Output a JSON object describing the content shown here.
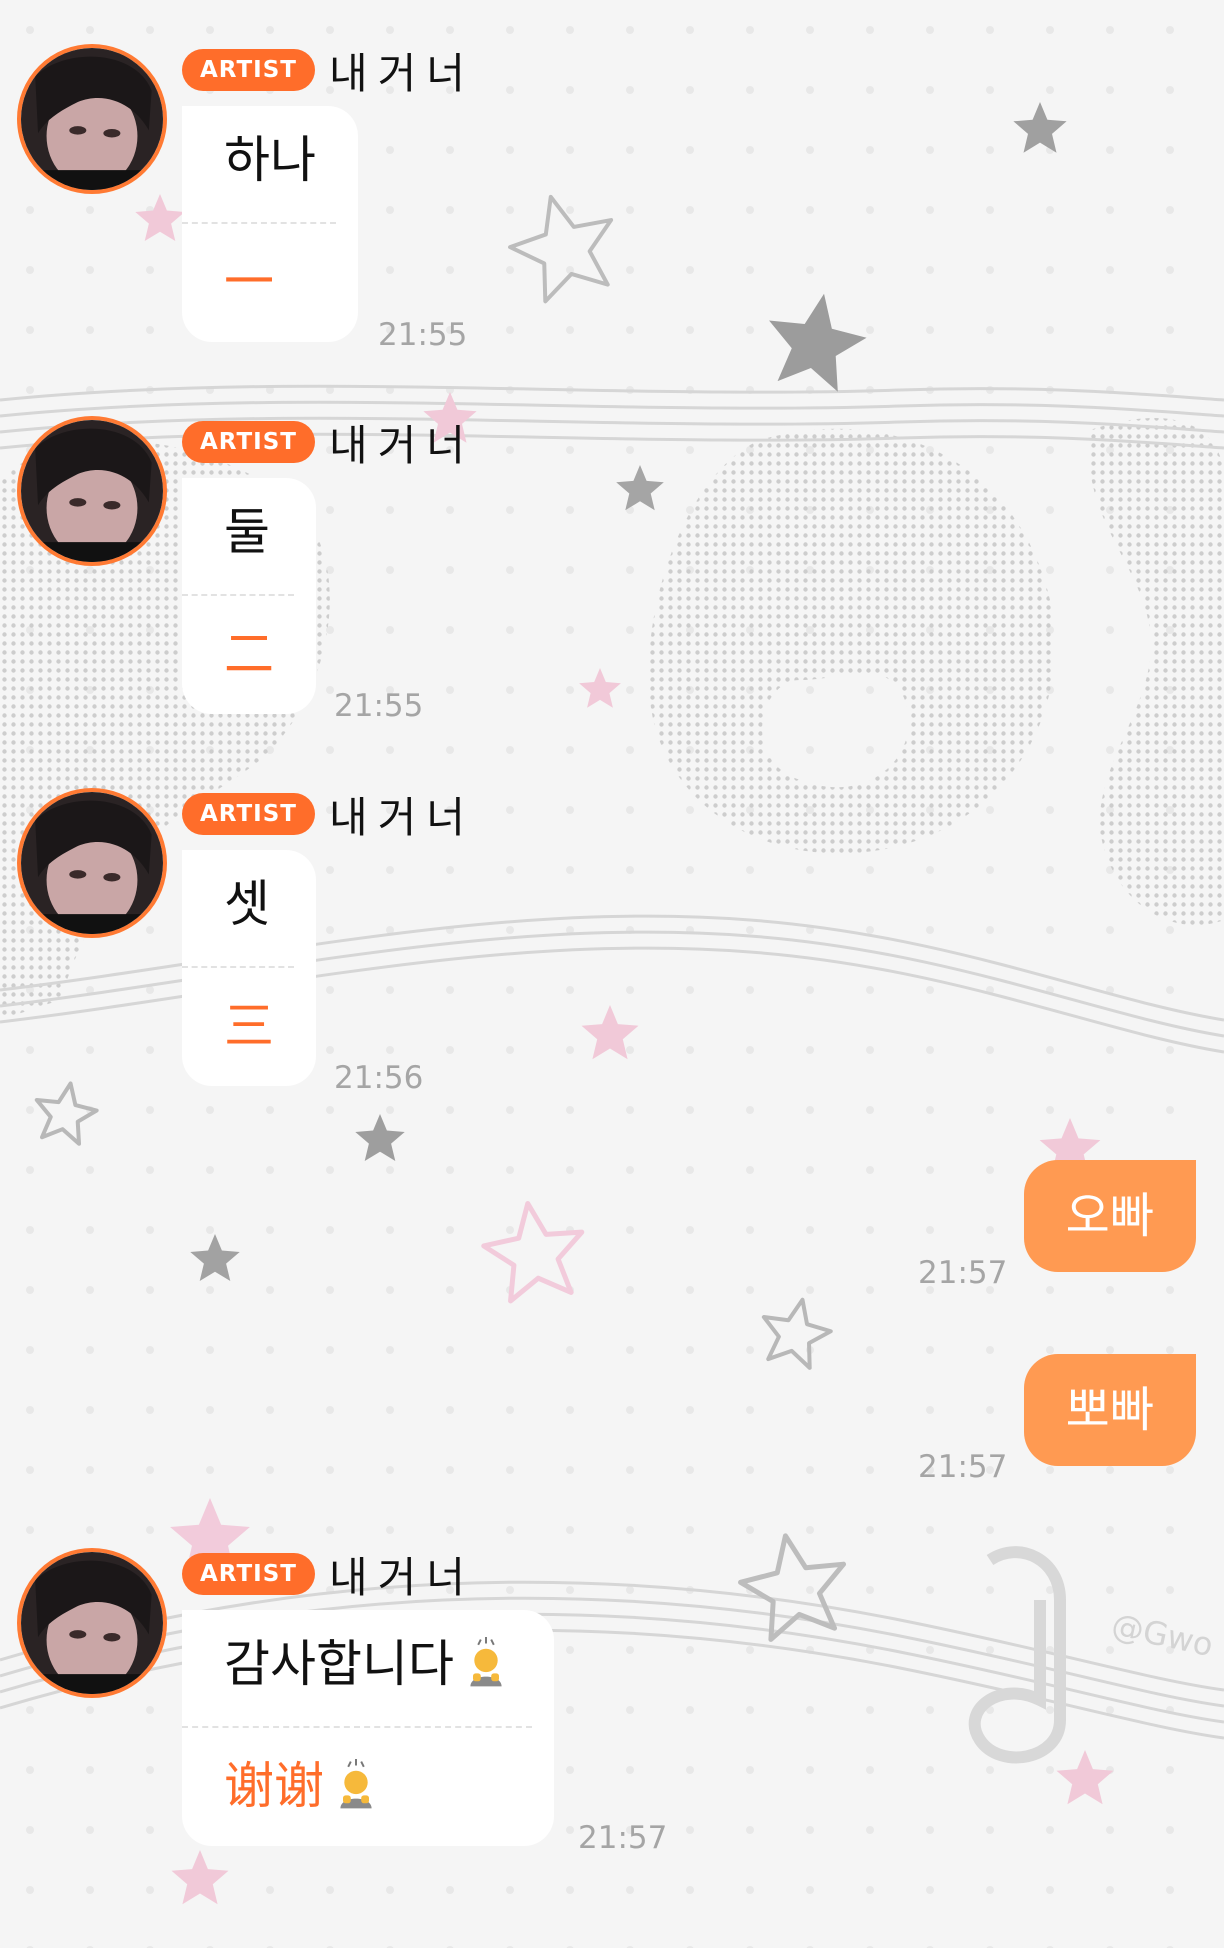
{
  "badge_label": "ARTIST",
  "sender_name": "내거너",
  "incoming": [
    {
      "korean": "하나",
      "translation": "一",
      "time": "21:55"
    },
    {
      "korean": "둘",
      "translation": "二",
      "time": "21:55"
    },
    {
      "korean": "셋",
      "translation": "三",
      "time": "21:56"
    },
    {
      "korean": "감사합니다",
      "translation": "谢谢",
      "time": "21:57"
    }
  ],
  "outgoing": [
    {
      "text": "오빠",
      "time": "21:57"
    },
    {
      "text": "뽀빠",
      "time": "21:57"
    }
  ],
  "watermark": "@Gwo",
  "icons": {
    "emoji": "person-bowing-icon",
    "avatar": "artist-avatar"
  },
  "colors": {
    "badge": "#ff6d2a",
    "outgoing_bubble": "#ff9a52",
    "avatar_ring": "#ff7a33",
    "translation_text": "#ff6d2a"
  }
}
